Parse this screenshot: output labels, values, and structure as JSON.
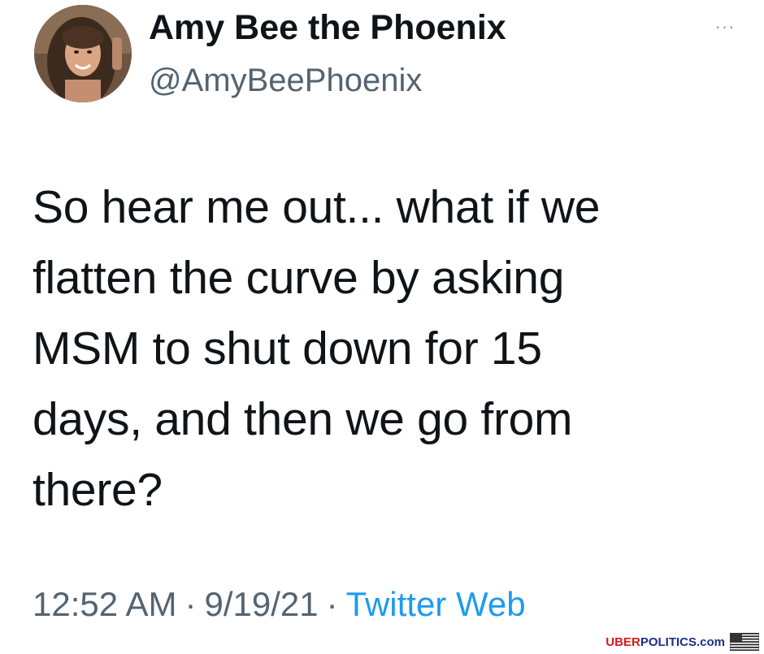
{
  "user": {
    "display_name": "Amy Bee the Phoenix",
    "handle": "@AmyBeePhoenix"
  },
  "menu": {
    "more_label": "···"
  },
  "tweet": {
    "lines": [
      "So hear me out... what if we",
      "flatten the curve by asking",
      "MSM to shut down for 15",
      "days, and then we go from",
      "there?"
    ]
  },
  "meta": {
    "time": "12:52 AM",
    "separator": "·",
    "date": "9/19/21",
    "source": "Twitter Web"
  },
  "watermark": {
    "uber": "UBER",
    "politics": "POLITICS",
    "dotcom": ".com"
  },
  "colors": {
    "text": "#0f1419",
    "secondary": "#536471",
    "link": "#1d9bf0"
  },
  "icons": {
    "avatar": "profile-photo",
    "more": "more-options-icon",
    "flag": "us-flag-icon"
  }
}
